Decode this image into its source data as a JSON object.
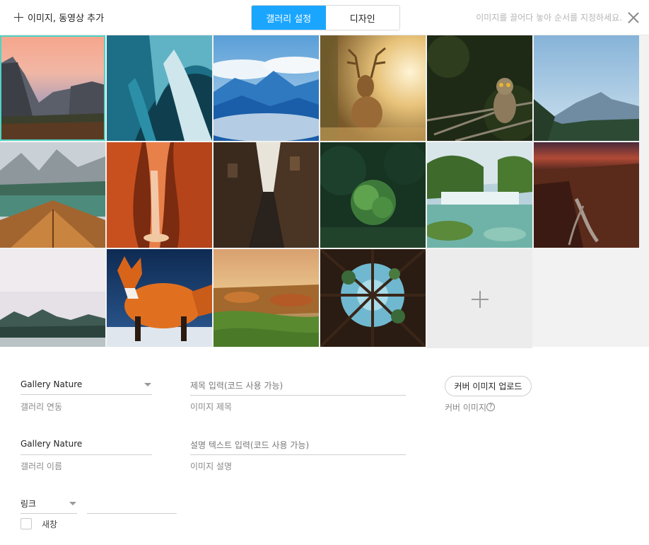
{
  "header": {
    "add_label": "이미지, 동영상 추가",
    "tabs": [
      {
        "label": "갤러리 설정",
        "active": true
      },
      {
        "label": "디자인",
        "active": false
      }
    ],
    "hint": "이미지를 끌어다 놓아 순서를 지정하세요."
  },
  "colors": {
    "accent": "#1aa6ff",
    "selected_outline": "#4fd3c4"
  },
  "grid": {
    "images": [
      {
        "name": "photo-yosemite-sunset",
        "selected": true
      },
      {
        "name": "photo-ice-cave"
      },
      {
        "name": "photo-blue-mountains-clouds"
      },
      {
        "name": "photo-deer-sunlight"
      },
      {
        "name": "photo-owl-branch"
      },
      {
        "name": "photo-mountain-lake"
      },
      {
        "name": "photo-lake-boat"
      },
      {
        "name": "photo-antelope-canyon"
      },
      {
        "name": "photo-narrow-alley"
      },
      {
        "name": "photo-green-plant"
      },
      {
        "name": "photo-waterfall"
      },
      {
        "name": "photo-canyon-dusk"
      },
      {
        "name": "photo-misty-forest"
      },
      {
        "name": "photo-red-fox"
      },
      {
        "name": "photo-autumn-village"
      },
      {
        "name": "photo-trees-from-below"
      }
    ]
  },
  "form": {
    "gallery_link": {
      "value": "Gallery Nature",
      "caption": "갤러리 연동"
    },
    "gallery_name": {
      "value": "Gallery Nature",
      "caption": "갤러리 이름"
    },
    "image_title": {
      "placeholder": "제목 입력(코드 사용 가능)",
      "caption": "이미지 제목"
    },
    "image_desc": {
      "placeholder": "설명 텍스트 입력(코드 사용 가능)",
      "caption": "이미지 설명"
    },
    "cover": {
      "button_label": "커버 이미지 업로드",
      "caption": "커버 이미지",
      "help": "?"
    },
    "link": {
      "select_value": "링크",
      "url_value": "",
      "new_window_label": "새창"
    }
  }
}
